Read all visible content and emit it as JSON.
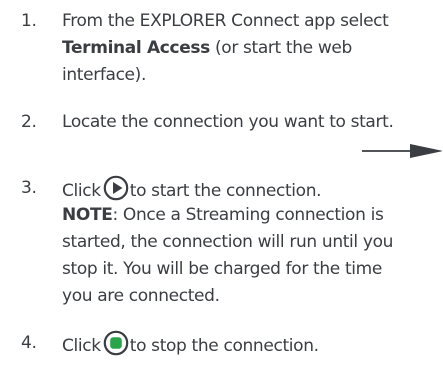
{
  "steps": [
    {
      "number": "1.",
      "line1": "From the EXPLORER Connect app select",
      "line2_bold": "Terminal Access",
      "line2_rest": " (or start the web",
      "line3": "interface)."
    },
    {
      "number": "2.",
      "line1": "Locate the connection you want to start."
    },
    {
      "number": "3.",
      "line1_before": "Click",
      "line1_after": "to start the connection.",
      "play_icon": "play-circle-icon",
      "note_label": "NOTE",
      "note_line1_rest": ": Once a Streaming connection is",
      "note_line2": "started, the connection will run until you",
      "note_line3": "stop it. You will be charged for the time",
      "note_line4": "you are connected."
    },
    {
      "number": "4.",
      "line1_before": "Click",
      "line1_after": "to stop the connection.",
      "stop_icon": "stop-circle-icon"
    }
  ],
  "arrow_icon": "right-arrow-icon",
  "colors": {
    "text": "#3a3d42",
    "stop_green": "#2aa44a"
  }
}
